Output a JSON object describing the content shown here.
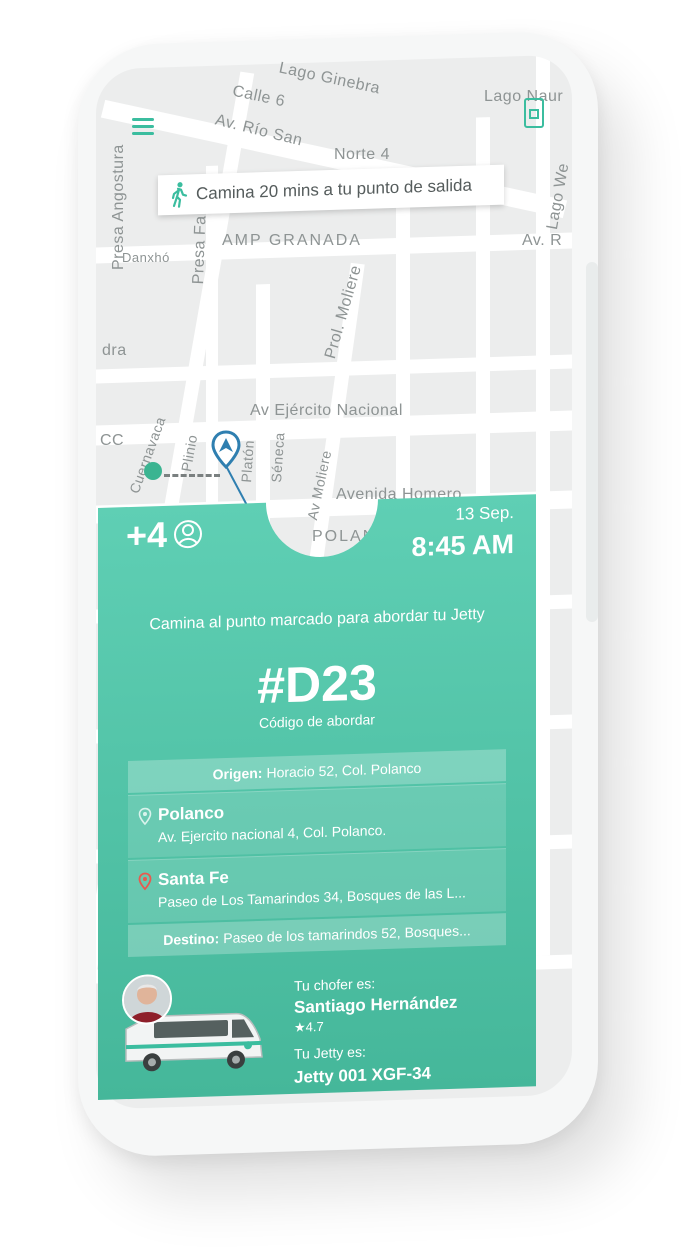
{
  "map": {
    "streets": [
      "Lago Ginebra",
      "Calle 6",
      "Lago Naur",
      "Av. Río San",
      "Norte 4",
      "Lago We",
      "Presa Angostura",
      "Presa Fa",
      "AMP GRANADA",
      "Av. R",
      "Danxhó",
      "Prol. Moliere",
      "dra",
      "Av Ejército Nacional",
      "CC",
      "Cuernavaca",
      "Plinio",
      "Platón",
      "Séneca",
      "Av Moliere",
      "Avenida Homero",
      "POLAN"
    ]
  },
  "banner": {
    "walk_icon": "walking-person-icon",
    "text": "Camina 20 mins a tu punto de salida"
  },
  "ticket": {
    "passengers": "+4",
    "date": "13 Sep.",
    "time": "8:45 AM",
    "instruction": "Camina al punto marcado para abordar tu Jetty",
    "code": "#D23",
    "code_label": "Código de abordar",
    "origin_label": "Origen:",
    "origin_value": "Horacio 52, Col. Polanco",
    "stops": [
      {
        "name": "Polanco",
        "address": "Av. Ejercito nacional 4, Col. Polanco."
      },
      {
        "name": "Santa Fe",
        "address": "Paseo de Los Tamarindos 34, Bosques de las L..."
      }
    ],
    "dest_label": "Destino:",
    "dest_value": "Paseo de los tamarindos 52, Bosques...",
    "driver_label": "Tu chofer es:",
    "driver_name": "Santiago Hernández",
    "driver_rating": "★4.7",
    "jetty_label": "Tu Jetty es:",
    "jetty_id": "Jetty 001 XGF-34"
  },
  "colors": {
    "accent": "#3bbd9f",
    "ticket_top": "#5fcfb4",
    "ticket_bottom": "#45b79a",
    "pin": "#2f7fb0",
    "stop_pin_santa_fe": "#e85a4f"
  }
}
